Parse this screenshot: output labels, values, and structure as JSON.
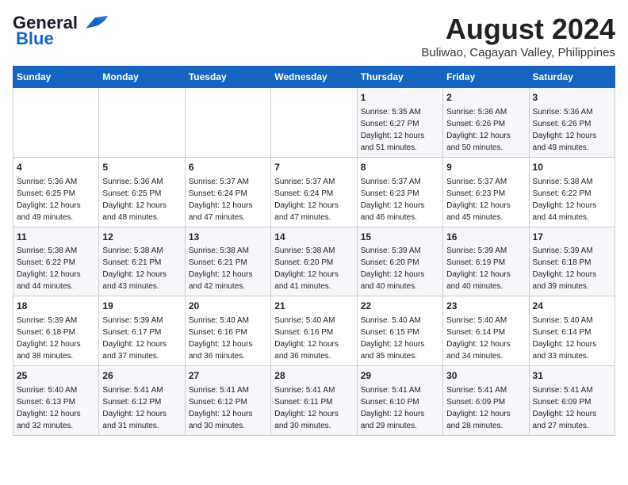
{
  "logo": {
    "line1": "General",
    "line2": "Blue"
  },
  "title": "August 2024",
  "subtitle": "Buliwao, Cagayan Valley, Philippines",
  "days_header": [
    "Sunday",
    "Monday",
    "Tuesday",
    "Wednesday",
    "Thursday",
    "Friday",
    "Saturday"
  ],
  "weeks": [
    [
      {
        "day": "",
        "content": ""
      },
      {
        "day": "",
        "content": ""
      },
      {
        "day": "",
        "content": ""
      },
      {
        "day": "",
        "content": ""
      },
      {
        "day": "1",
        "content": "Sunrise: 5:35 AM\nSunset: 6:27 PM\nDaylight: 12 hours\nand 51 minutes."
      },
      {
        "day": "2",
        "content": "Sunrise: 5:36 AM\nSunset: 6:26 PM\nDaylight: 12 hours\nand 50 minutes."
      },
      {
        "day": "3",
        "content": "Sunrise: 5:36 AM\nSunset: 6:26 PM\nDaylight: 12 hours\nand 49 minutes."
      }
    ],
    [
      {
        "day": "4",
        "content": "Sunrise: 5:36 AM\nSunset: 6:25 PM\nDaylight: 12 hours\nand 49 minutes."
      },
      {
        "day": "5",
        "content": "Sunrise: 5:36 AM\nSunset: 6:25 PM\nDaylight: 12 hours\nand 48 minutes."
      },
      {
        "day": "6",
        "content": "Sunrise: 5:37 AM\nSunset: 6:24 PM\nDaylight: 12 hours\nand 47 minutes."
      },
      {
        "day": "7",
        "content": "Sunrise: 5:37 AM\nSunset: 6:24 PM\nDaylight: 12 hours\nand 47 minutes."
      },
      {
        "day": "8",
        "content": "Sunrise: 5:37 AM\nSunset: 6:23 PM\nDaylight: 12 hours\nand 46 minutes."
      },
      {
        "day": "9",
        "content": "Sunrise: 5:37 AM\nSunset: 6:23 PM\nDaylight: 12 hours\nand 45 minutes."
      },
      {
        "day": "10",
        "content": "Sunrise: 5:38 AM\nSunset: 6:22 PM\nDaylight: 12 hours\nand 44 minutes."
      }
    ],
    [
      {
        "day": "11",
        "content": "Sunrise: 5:38 AM\nSunset: 6:22 PM\nDaylight: 12 hours\nand 44 minutes."
      },
      {
        "day": "12",
        "content": "Sunrise: 5:38 AM\nSunset: 6:21 PM\nDaylight: 12 hours\nand 43 minutes."
      },
      {
        "day": "13",
        "content": "Sunrise: 5:38 AM\nSunset: 6:21 PM\nDaylight: 12 hours\nand 42 minutes."
      },
      {
        "day": "14",
        "content": "Sunrise: 5:38 AM\nSunset: 6:20 PM\nDaylight: 12 hours\nand 41 minutes."
      },
      {
        "day": "15",
        "content": "Sunrise: 5:39 AM\nSunset: 6:20 PM\nDaylight: 12 hours\nand 40 minutes."
      },
      {
        "day": "16",
        "content": "Sunrise: 5:39 AM\nSunset: 6:19 PM\nDaylight: 12 hours\nand 40 minutes."
      },
      {
        "day": "17",
        "content": "Sunrise: 5:39 AM\nSunset: 6:18 PM\nDaylight: 12 hours\nand 39 minutes."
      }
    ],
    [
      {
        "day": "18",
        "content": "Sunrise: 5:39 AM\nSunset: 6:18 PM\nDaylight: 12 hours\nand 38 minutes."
      },
      {
        "day": "19",
        "content": "Sunrise: 5:39 AM\nSunset: 6:17 PM\nDaylight: 12 hours\nand 37 minutes."
      },
      {
        "day": "20",
        "content": "Sunrise: 5:40 AM\nSunset: 6:16 PM\nDaylight: 12 hours\nand 36 minutes."
      },
      {
        "day": "21",
        "content": "Sunrise: 5:40 AM\nSunset: 6:16 PM\nDaylight: 12 hours\nand 36 minutes."
      },
      {
        "day": "22",
        "content": "Sunrise: 5:40 AM\nSunset: 6:15 PM\nDaylight: 12 hours\nand 35 minutes."
      },
      {
        "day": "23",
        "content": "Sunrise: 5:40 AM\nSunset: 6:14 PM\nDaylight: 12 hours\nand 34 minutes."
      },
      {
        "day": "24",
        "content": "Sunrise: 5:40 AM\nSunset: 6:14 PM\nDaylight: 12 hours\nand 33 minutes."
      }
    ],
    [
      {
        "day": "25",
        "content": "Sunrise: 5:40 AM\nSunset: 6:13 PM\nDaylight: 12 hours\nand 32 minutes."
      },
      {
        "day": "26",
        "content": "Sunrise: 5:41 AM\nSunset: 6:12 PM\nDaylight: 12 hours\nand 31 minutes."
      },
      {
        "day": "27",
        "content": "Sunrise: 5:41 AM\nSunset: 6:12 PM\nDaylight: 12 hours\nand 30 minutes."
      },
      {
        "day": "28",
        "content": "Sunrise: 5:41 AM\nSunset: 6:11 PM\nDaylight: 12 hours\nand 30 minutes."
      },
      {
        "day": "29",
        "content": "Sunrise: 5:41 AM\nSunset: 6:10 PM\nDaylight: 12 hours\nand 29 minutes."
      },
      {
        "day": "30",
        "content": "Sunrise: 5:41 AM\nSunset: 6:09 PM\nDaylight: 12 hours\nand 28 minutes."
      },
      {
        "day": "31",
        "content": "Sunrise: 5:41 AM\nSunset: 6:09 PM\nDaylight: 12 hours\nand 27 minutes."
      }
    ]
  ]
}
